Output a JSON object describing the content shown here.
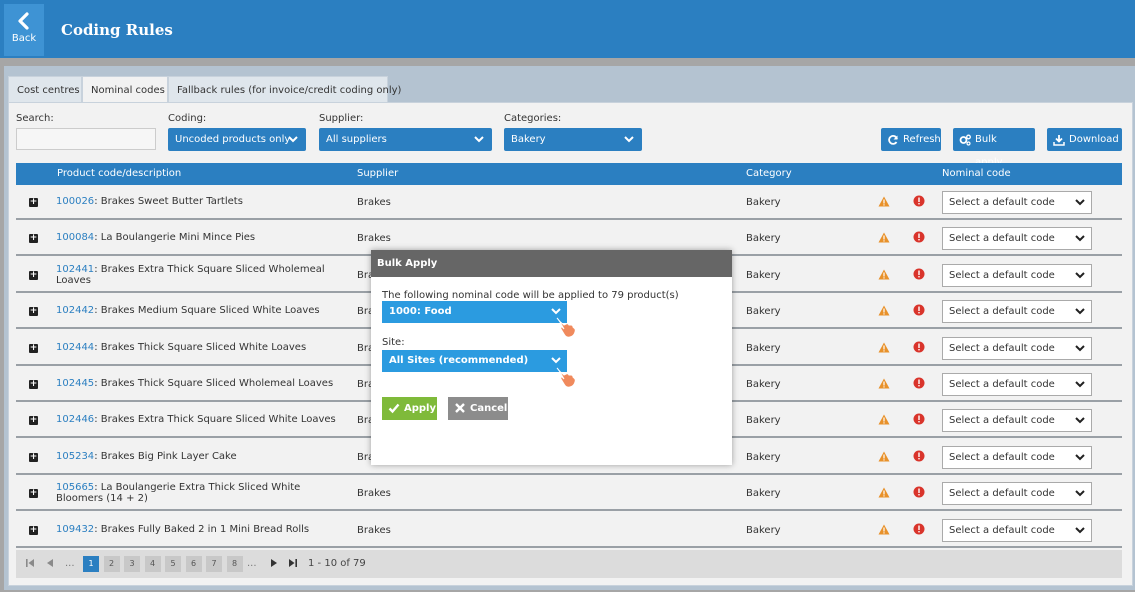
{
  "header": {
    "back_label": "Back",
    "title": "Coding Rules",
    "bg_color": "#2b7fc1"
  },
  "tabs": [
    {
      "label": "Cost centres",
      "active": false
    },
    {
      "label": "Nominal codes",
      "active": true
    },
    {
      "label": "Fallback rules (for invoice/credit coding only)",
      "active": false
    }
  ],
  "filters": {
    "search_label": "Search:",
    "search_value": "",
    "coding_label": "Coding:",
    "coding_value": "Uncoded products only",
    "supplier_label": "Supplier:",
    "supplier_value": "All suppliers",
    "categories_label": "Categories:",
    "categories_value": "Bakery"
  },
  "toolbar": {
    "refresh_label": "Refresh",
    "bulk_apply_label": "Bulk apply...",
    "download_label": "Download"
  },
  "table": {
    "columns": {
      "product": "Product code/description",
      "supplier": "Supplier",
      "category": "Category",
      "nominal": "Nominal code"
    },
    "rows": [
      {
        "code": "100026",
        "desc": "Brakes Sweet Butter Tartlets",
        "supplier": "Brakes",
        "category": "Bakery",
        "nominal": "Select a default code"
      },
      {
        "code": "100084",
        "desc": "La Boulangerie Mini Mince Pies",
        "supplier": "Brakes",
        "category": "Bakery",
        "nominal": "Select a default code"
      },
      {
        "code": "102441",
        "desc": "Brakes Extra Thick Square Sliced Wholemeal Loaves",
        "supplier": "Bra",
        "category": "Bakery",
        "nominal": "Select a default code"
      },
      {
        "code": "102442",
        "desc": "Brakes Medium Square Sliced White Loaves",
        "supplier": "Bra",
        "category": "Bakery",
        "nominal": "Select a default code"
      },
      {
        "code": "102444",
        "desc": "Brakes Thick Square Sliced White Loaves",
        "supplier": "Bra",
        "category": "Bakery",
        "nominal": "Select a default code"
      },
      {
        "code": "102445",
        "desc": "Brakes Thick Square Sliced Wholemeal Loaves",
        "supplier": "Bra",
        "category": "Bakery",
        "nominal": "Select a default code"
      },
      {
        "code": "102446",
        "desc": "Brakes Extra Thick Square Sliced White Loaves",
        "supplier": "Bra",
        "category": "Bakery",
        "nominal": "Select a default code"
      },
      {
        "code": "105234",
        "desc": "Brakes Big Pink Layer Cake",
        "supplier": "Bra",
        "category": "Bakery",
        "nominal": "Select a default code"
      },
      {
        "code": "105665",
        "desc": "La Boulangerie Extra Thick Sliced White Bloomers (14 + 2)",
        "supplier": "Brakes",
        "category": "Bakery",
        "nominal": "Select a default code"
      },
      {
        "code": "109432",
        "desc": "Brakes Fully Baked 2 in 1 Mini Bread Rolls",
        "supplier": "Brakes",
        "category": "Bakery",
        "nominal": "Select a default code"
      }
    ]
  },
  "pager": {
    "pages": [
      "1",
      "2",
      "3",
      "4",
      "5",
      "6",
      "7",
      "8"
    ],
    "current": "1",
    "dots": "...",
    "info": "1 - 10 of 79"
  },
  "modal": {
    "title": "Bulk Apply",
    "message": "The following nominal code will be applied to 79 product(s)",
    "nominal_value": "1000: Food",
    "site_label": "Site:",
    "site_value": "All Sites (recommended)",
    "apply_label": "Apply",
    "cancel_label": "Cancel"
  },
  "colors": {
    "accent": "#2b7fc1",
    "warning": "#e8912a",
    "error": "#d9342b",
    "apply": "#7fba3a",
    "cancel": "#8c8c8c"
  }
}
